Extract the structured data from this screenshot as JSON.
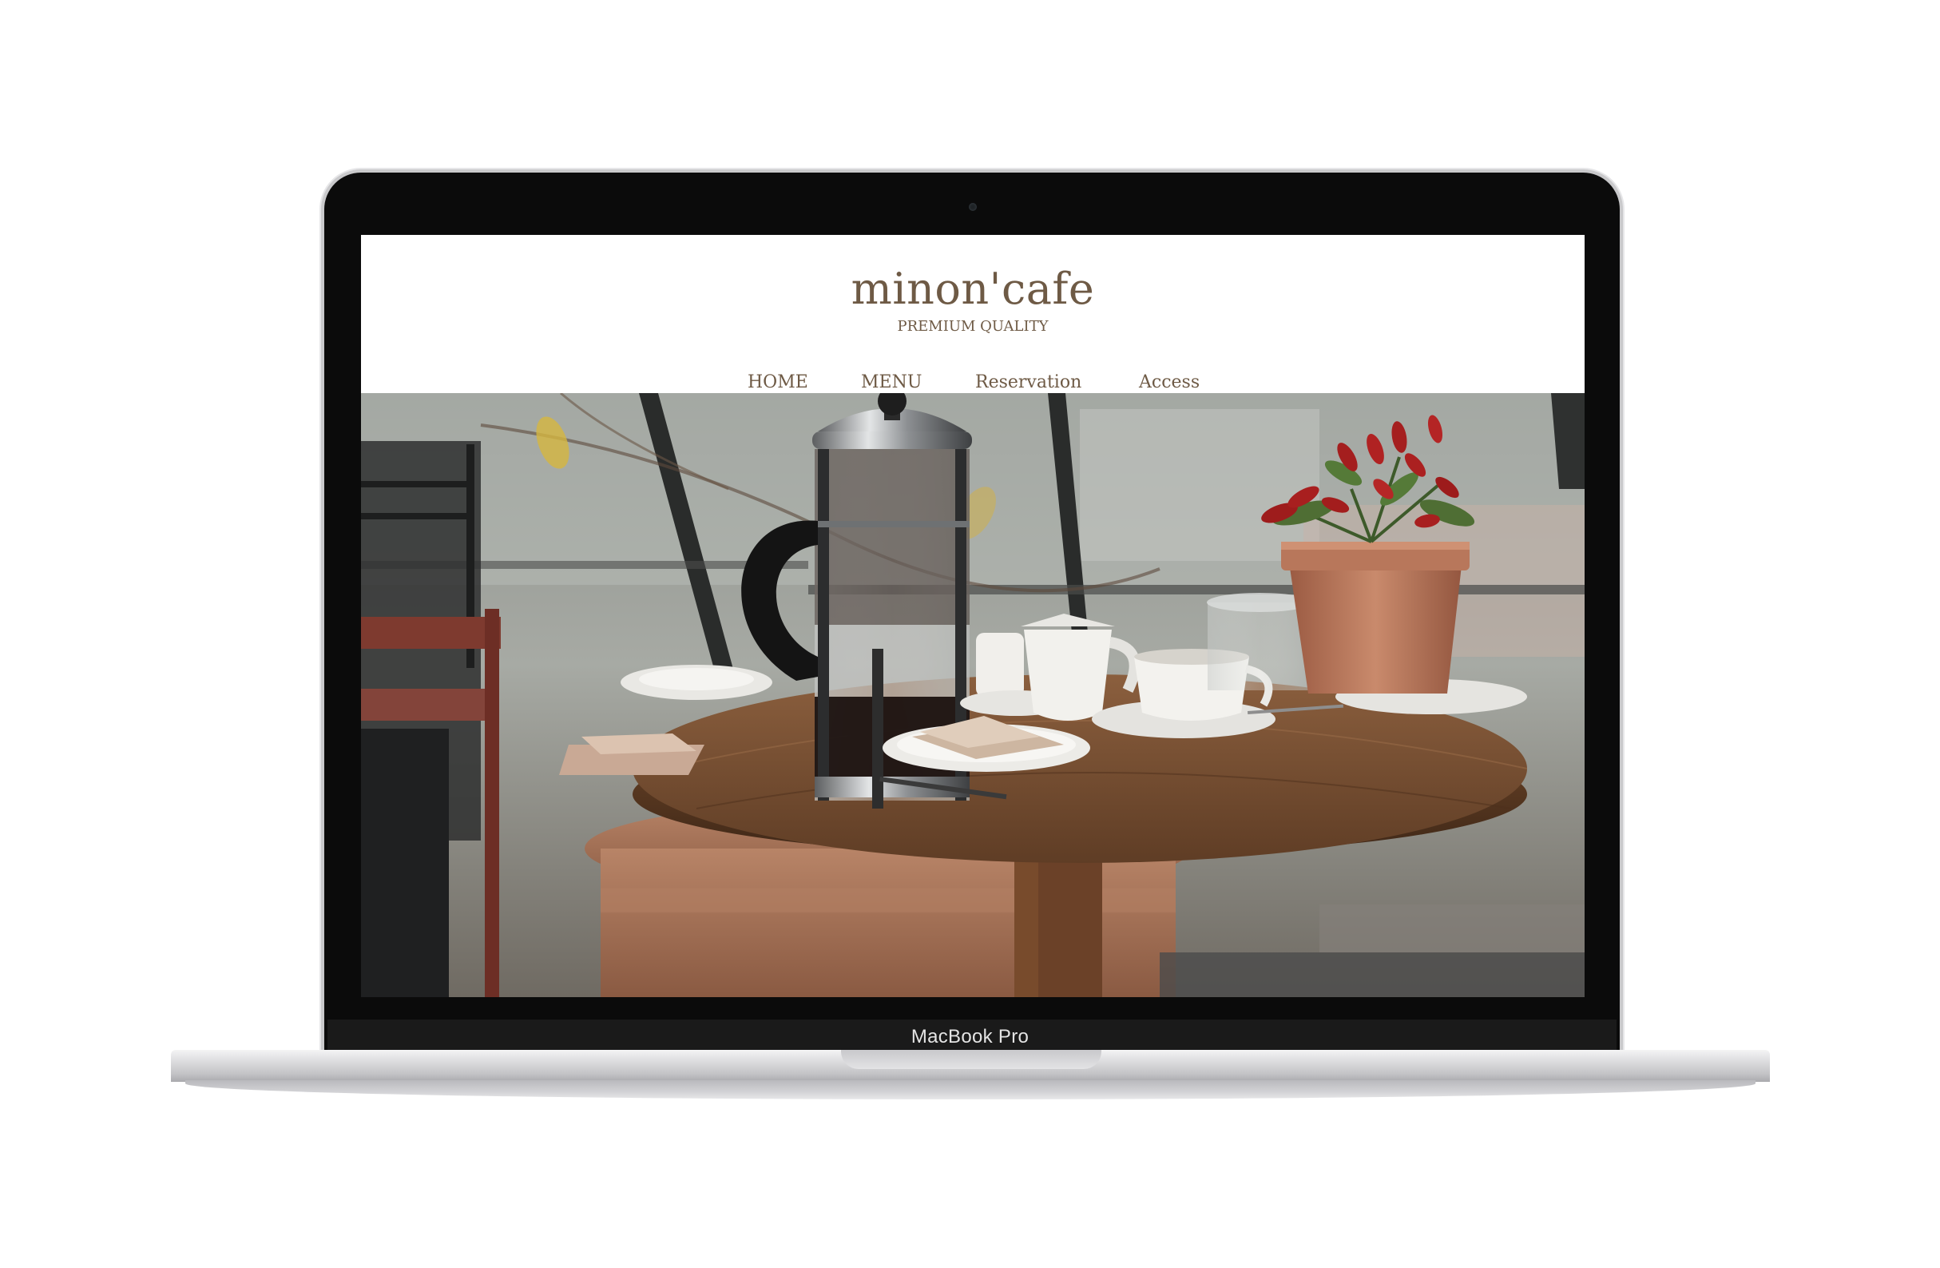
{
  "device": {
    "chin_label": "MacBook Pro"
  },
  "site": {
    "logo": "minon'cafe",
    "tagline": "PREMIUM QUALITY",
    "nav": {
      "home": "HOME",
      "menu": "MENU",
      "reservation": "Reservation",
      "access": "Access"
    },
    "hero": {
      "alt": "cafe table with french press, cups and potted chili plant"
    }
  },
  "colors": {
    "brand_text": "#6e5a45",
    "bezel": "#0b0b0b"
  }
}
